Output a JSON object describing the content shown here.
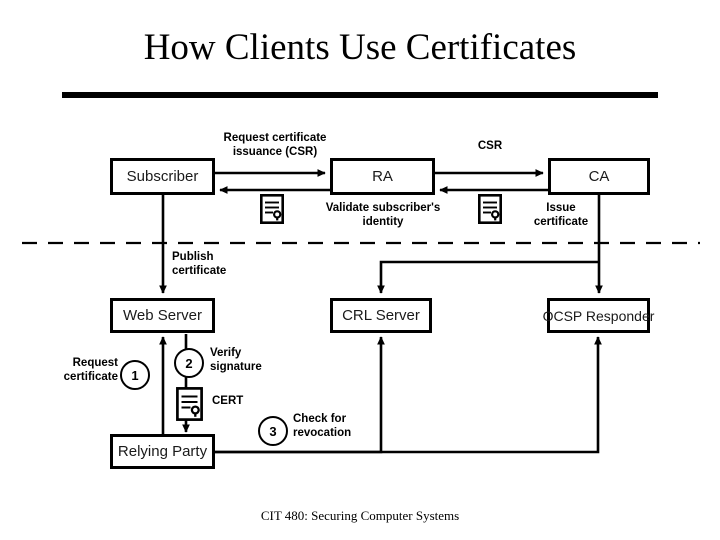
{
  "slide": {
    "title": "How Clients Use Certificates",
    "footer": "CIT 480: Securing Computer Systems"
  },
  "diagram": {
    "nodes": [
      {
        "id": "subscriber",
        "label": "Subscriber"
      },
      {
        "id": "ra",
        "label": "RA"
      },
      {
        "id": "ca",
        "label": "CA"
      },
      {
        "id": "web_server",
        "label": "Web Server"
      },
      {
        "id": "crl_server",
        "label": "CRL Server"
      },
      {
        "id": "ocsp_responder",
        "label": "OCSP Responder"
      },
      {
        "id": "relying_party",
        "label": "Relying Party"
      }
    ],
    "labels": {
      "request_csr_line1": "Request certificate",
      "request_csr_line2": "issuance (CSR)",
      "csr": "CSR",
      "validate_line1": "Validate subscriber's",
      "validate_line2": "identity",
      "issue_line1": "Issue",
      "issue_line2": "certificate",
      "publish_line1": "Publish",
      "publish_line2": "certificate",
      "request_cert_line1": "Request",
      "request_cert_line2": "certificate",
      "verify_line1": "Verify",
      "verify_line2": "signature",
      "cert_tag": "CERT",
      "check_line1": "Check for",
      "check_line2": "revocation"
    },
    "steps": [
      {
        "number": "1",
        "action": "Request certificate"
      },
      {
        "number": "2",
        "action": "Verify signature"
      },
      {
        "number": "3",
        "action": "Check for revocation"
      }
    ],
    "icons": [
      {
        "name": "certificate-icon-csr"
      },
      {
        "name": "certificate-icon-issued"
      },
      {
        "name": "certificate-icon-cert"
      }
    ],
    "colors": {
      "ink": "#000000",
      "background": "#ffffff",
      "box_text": "#1a1a1a"
    }
  }
}
